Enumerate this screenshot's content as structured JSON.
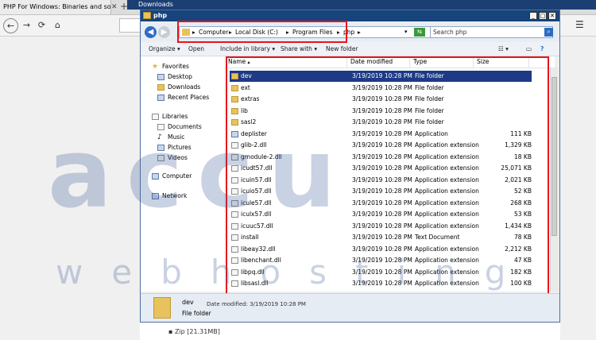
{
  "browser": {
    "tab_title": "PHP For Windows: Binaries and sources",
    "tab_close": "✕",
    "new_tab": "+",
    "downloads_title": "Downloads",
    "zip_text": "▪ Zip [21.31MB]",
    "menu_icon": "☰",
    "back": "←",
    "forward": "→",
    "reload": "⟳",
    "home": "⌂"
  },
  "window": {
    "title": "php",
    "minimize": "_",
    "maximize": "□",
    "close": "✕"
  },
  "address": {
    "crumbs": [
      "Computer",
      "Local Disk (C:)",
      "Program Files",
      "php"
    ],
    "separator": "▸",
    "search_placeholder": "Search php"
  },
  "toolbar": {
    "organize": "Organize ▾",
    "open": "Open",
    "include": "Include in library ▾",
    "share": "Share with ▾",
    "new_folder": "New folder"
  },
  "nav": {
    "favorites": "Favorites",
    "desktop": "Desktop",
    "downloads": "Downloads",
    "recent": "Recent Places",
    "libraries": "Libraries",
    "documents": "Documents",
    "music": "Music",
    "pictures": "Pictures",
    "videos": "Videos",
    "computer": "Computer",
    "network": "Network"
  },
  "columns": {
    "name": "Name",
    "date": "Date modified",
    "type": "Type",
    "size": "Size"
  },
  "files": [
    {
      "name": "dev",
      "date": "3/19/2019 10:28 PM",
      "type": "File folder",
      "size": "",
      "kind": "folder",
      "selected": true
    },
    {
      "name": "ext",
      "date": "3/19/2019 10:28 PM",
      "type": "File folder",
      "size": "",
      "kind": "folder"
    },
    {
      "name": "extras",
      "date": "3/19/2019 10:28 PM",
      "type": "File folder",
      "size": "",
      "kind": "folder"
    },
    {
      "name": "lib",
      "date": "3/19/2019 10:28 PM",
      "type": "File folder",
      "size": "",
      "kind": "folder"
    },
    {
      "name": "sasl2",
      "date": "3/19/2019 10:28 PM",
      "type": "File folder",
      "size": "",
      "kind": "folder"
    },
    {
      "name": "deplister",
      "date": "3/19/2019 10:28 PM",
      "type": "Application",
      "size": "111 KB",
      "kind": "app"
    },
    {
      "name": "glib-2.dll",
      "date": "3/19/2019 10:28 PM",
      "type": "Application extension",
      "size": "1,329 KB",
      "kind": "file"
    },
    {
      "name": "gmodule-2.dll",
      "date": "3/19/2019 10:28 PM",
      "type": "Application extension",
      "size": "18 KB",
      "kind": "file"
    },
    {
      "name": "icudt57.dll",
      "date": "3/19/2019 10:28 PM",
      "type": "Application extension",
      "size": "25,071 KB",
      "kind": "file"
    },
    {
      "name": "icuin57.dll",
      "date": "3/19/2019 10:28 PM",
      "type": "Application extension",
      "size": "2,021 KB",
      "kind": "file"
    },
    {
      "name": "icuio57.dll",
      "date": "3/19/2019 10:28 PM",
      "type": "Application extension",
      "size": "52 KB",
      "kind": "file"
    },
    {
      "name": "icule57.dll",
      "date": "3/19/2019 10:28 PM",
      "type": "Application extension",
      "size": "268 KB",
      "kind": "file"
    },
    {
      "name": "iculx57.dll",
      "date": "3/19/2019 10:28 PM",
      "type": "Application extension",
      "size": "53 KB",
      "kind": "file"
    },
    {
      "name": "icuuc57.dll",
      "date": "3/19/2019 10:28 PM",
      "type": "Application extension",
      "size": "1,434 KB",
      "kind": "file"
    },
    {
      "name": "install",
      "date": "3/19/2019 10:28 PM",
      "type": "Text Document",
      "size": "78 KB",
      "kind": "file"
    },
    {
      "name": "libeay32.dll",
      "date": "3/19/2019 10:28 PM",
      "type": "Application extension",
      "size": "2,212 KB",
      "kind": "file"
    },
    {
      "name": "libenchant.dll",
      "date": "3/19/2019 10:28 PM",
      "type": "Application extension",
      "size": "47 KB",
      "kind": "file"
    },
    {
      "name": "libpq.dll",
      "date": "3/19/2019 10:28 PM",
      "type": "Application extension",
      "size": "182 KB",
      "kind": "file"
    },
    {
      "name": "libsasl.dll",
      "date": "3/19/2019 10:28 PM",
      "type": "Application extension",
      "size": "100 KB",
      "kind": "file"
    }
  ],
  "details": {
    "name": "dev",
    "type": "File folder",
    "date": "Date modified: 3/19/2019 10:28 PM"
  },
  "watermark": {
    "big": "accu",
    "small": "webhosting"
  },
  "colors": {
    "highlight": "#e8141b",
    "selection": "#1c3a86",
    "titlebar": "#17447c"
  }
}
